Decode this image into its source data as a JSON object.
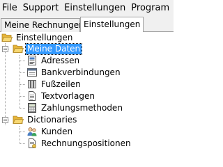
{
  "menubar": {
    "items": [
      "File",
      "Support",
      "Einstellungen",
      "Program"
    ]
  },
  "tabs": [
    {
      "label": "Meine Rechnungen",
      "active": false
    },
    {
      "label": "Einstellungen",
      "active": true
    }
  ],
  "tree": {
    "root": "Einstellungen",
    "meine_daten": "Meine Daten",
    "meine_daten_children": [
      "Adressen",
      "Bankverbindungen",
      "Fußzeilen",
      "Textvorlagen",
      "Zahlungsmethoden"
    ],
    "dictionaries": "Dictionaries",
    "dictionaries_children": [
      "Kunden",
      "Rechnungspositionen"
    ]
  },
  "colors": {
    "selection": "#3399ff",
    "folder": "#f2c94c",
    "chrome": "#f0f0f0"
  }
}
